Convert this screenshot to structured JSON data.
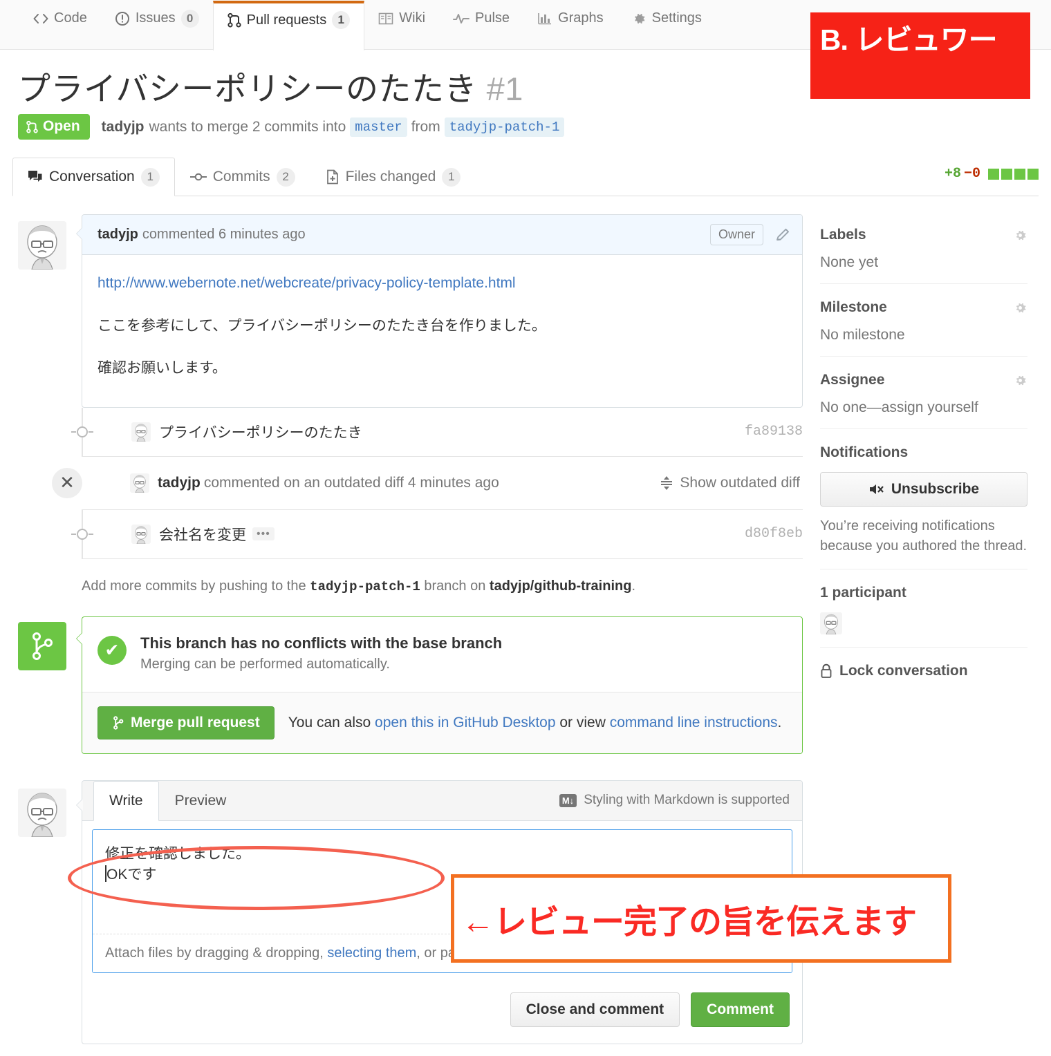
{
  "repo_nav": {
    "items": [
      {
        "label": "Code",
        "icon": "code-icon",
        "counter": null,
        "selected": false
      },
      {
        "label": "Issues",
        "icon": "issue-opened-icon",
        "counter": "0",
        "selected": false
      },
      {
        "label": "Pull requests",
        "icon": "git-pull-request-icon",
        "counter": "1",
        "selected": true
      },
      {
        "label": "Wiki",
        "icon": "book-icon",
        "counter": null,
        "selected": false
      },
      {
        "label": "Pulse",
        "icon": "pulse-icon",
        "counter": null,
        "selected": false
      },
      {
        "label": "Graphs",
        "icon": "graph-icon",
        "counter": null,
        "selected": false
      },
      {
        "label": "Settings",
        "icon": "gear-icon",
        "counter": null,
        "selected": false
      }
    ]
  },
  "pull_request": {
    "title": "プライバシーポリシーのたたき",
    "number": "#1",
    "state": "Open",
    "meta": {
      "author": "tadyjp",
      "text_before": "wants to merge 2 commits into",
      "base_branch": "master",
      "text_mid": "from",
      "head_branch": "tadyjp-patch-1"
    },
    "tabs": [
      {
        "label": "Conversation",
        "counter": "1",
        "icon": "comment-discussion-icon",
        "active": true
      },
      {
        "label": "Commits",
        "counter": "2",
        "icon": "git-commit-icon",
        "active": false
      },
      {
        "label": "Files changed",
        "counter": "1",
        "icon": "diff-icon",
        "active": false
      }
    ],
    "diffstat": {
      "additions": "+8",
      "deletions": "−0",
      "blocks": 4
    }
  },
  "timeline": {
    "comment": {
      "author": "tadyjp",
      "action": "commented 6 minutes ago",
      "badge": "Owner",
      "link": "http://www.webernote.net/webcreate/privacy-policy-template.html",
      "paragraphs": [
        "ここを参考にして、プライバシーポリシーのたたき台を作りました。",
        "確認お願いします。"
      ]
    },
    "commits": [
      {
        "message": "プライバシーポリシーのたたき",
        "sha": "fa89138",
        "ellipsis": false
      },
      {
        "message": "会社名を変更",
        "sha": "d80f8eb",
        "ellipsis": true
      }
    ],
    "outdated": {
      "author": "tadyjp",
      "text": "commented on an outdated diff 4 minutes ago",
      "action_label": "Show outdated diff"
    },
    "push_note": {
      "prefix": "Add more commits by pushing to the",
      "branch": "tadyjp-patch-1",
      "middle": "branch on",
      "repo": "tadyjp/github-training",
      "suffix": "."
    }
  },
  "merge": {
    "headline": "This branch has no conflicts with the base branch",
    "subline": "Merging can be performed automatically.",
    "merge_button": "Merge pull request",
    "hint_prefix": "You can also",
    "hint_link1": "open this in GitHub Desktop",
    "hint_mid": "or view",
    "hint_link2": "command line instructions",
    "hint_suffix": "."
  },
  "comment_form": {
    "tabs": [
      {
        "label": "Write",
        "active": true
      },
      {
        "label": "Preview",
        "active": false
      }
    ],
    "markdown_hint": "Styling with Markdown is supported",
    "markdown_badge": "M↓",
    "textarea_line1": "修正を確認しました。",
    "textarea_line2": "OKです",
    "attach_prefix": "Attach files by dragging & dropping,",
    "attach_link": "selecting them",
    "attach_suffix": ", or pasting from the clipboard.",
    "close_button": "Close and comment",
    "comment_button": "Comment"
  },
  "sidebar": {
    "labels": {
      "title": "Labels",
      "value": "None yet"
    },
    "milestone": {
      "title": "Milestone",
      "value": "No milestone"
    },
    "assignee": {
      "title": "Assignee",
      "value": "No one—assign yourself"
    },
    "notifications": {
      "title": "Notifications",
      "button": "Unsubscribe",
      "note": "You’re receiving notifications because you authored the thread."
    },
    "participants": {
      "title": "1 participant"
    },
    "lock": {
      "label": "Lock conversation"
    }
  },
  "annotations": {
    "role_badge": {
      "text": "B. レビュワー",
      "bg": "#f62217",
      "fg": "#ffffff"
    },
    "callout": {
      "text": "←レビュー完了の旨を伝えます",
      "border": "#f37021",
      "fg": "#fa2a24"
    },
    "ellipse_color": "#f4604f"
  }
}
